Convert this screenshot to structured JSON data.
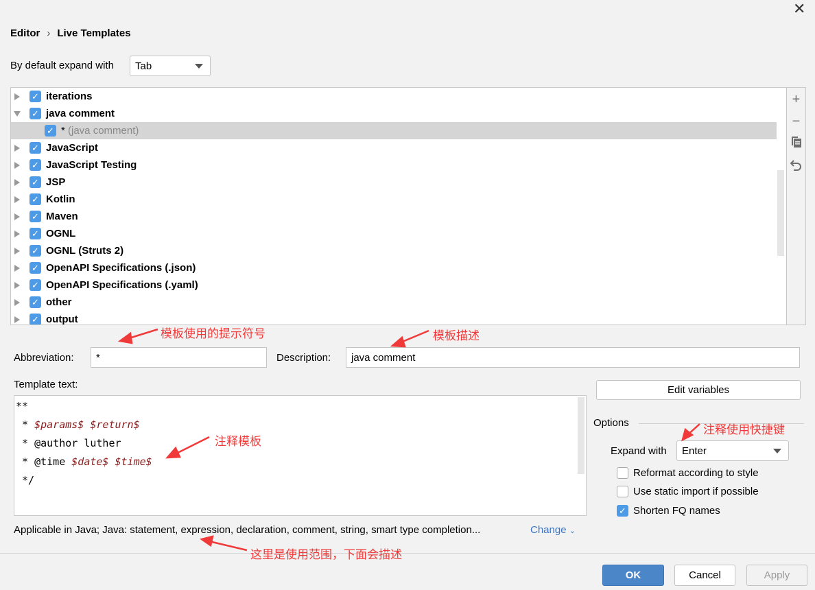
{
  "breadcrumb": {
    "parent": "Editor",
    "current": "Live Templates"
  },
  "expand_default": {
    "label": "By default expand with",
    "value": "Tab"
  },
  "tree": [
    {
      "label": "iterations",
      "checked": true,
      "expanded": false,
      "level": 0
    },
    {
      "label": "java comment",
      "checked": true,
      "expanded": true,
      "level": 0
    },
    {
      "label": "*",
      "desc": "(java comment)",
      "checked": true,
      "level": 1,
      "selected": true
    },
    {
      "label": "JavaScript",
      "checked": true,
      "expanded": false,
      "level": 0
    },
    {
      "label": "JavaScript Testing",
      "checked": true,
      "expanded": false,
      "level": 0
    },
    {
      "label": "JSP",
      "checked": true,
      "expanded": false,
      "level": 0
    },
    {
      "label": "Kotlin",
      "checked": true,
      "expanded": false,
      "level": 0
    },
    {
      "label": "Maven",
      "checked": true,
      "expanded": false,
      "level": 0
    },
    {
      "label": "OGNL",
      "checked": true,
      "expanded": false,
      "level": 0
    },
    {
      "label": "OGNL (Struts 2)",
      "checked": true,
      "expanded": false,
      "level": 0
    },
    {
      "label": "OpenAPI Specifications (.json)",
      "checked": true,
      "expanded": false,
      "level": 0
    },
    {
      "label": "OpenAPI Specifications (.yaml)",
      "checked": true,
      "expanded": false,
      "level": 0
    },
    {
      "label": "other",
      "checked": true,
      "expanded": false,
      "level": 0
    },
    {
      "label": "output",
      "checked": true,
      "expanded": false,
      "level": 0
    }
  ],
  "toolbar": {
    "add": "+",
    "remove": "−",
    "copy": "copy-icon",
    "restore": "undo-icon"
  },
  "abbreviation": {
    "label": "Abbreviation:",
    "value": "*"
  },
  "description": {
    "label": "Description:",
    "value": "java comment"
  },
  "template_text": {
    "label": "Template text:",
    "lines": [
      [
        {
          "t": "**"
        }
      ],
      [
        {
          "t": " * "
        },
        {
          "t": "$params$",
          "v": true
        },
        {
          "t": " "
        },
        {
          "t": "$return$",
          "v": true
        }
      ],
      [
        {
          "t": " * @author luther"
        }
      ],
      [
        {
          "t": " * @time "
        },
        {
          "t": "$date$",
          "v": true
        },
        {
          "t": " "
        },
        {
          "t": "$time$",
          "v": true
        }
      ],
      [
        {
          "t": " */"
        }
      ]
    ]
  },
  "edit_variables": "Edit variables",
  "options": {
    "title": "Options",
    "expand_label": "Expand with",
    "expand_value": "Enter",
    "reformat": {
      "label": "Reformat according to style",
      "checked": false
    },
    "static_import": {
      "label": "Use static import if possible",
      "checked": false
    },
    "shorten_fq": {
      "label": "Shorten FQ names",
      "checked": true
    }
  },
  "applicable": {
    "text": "Applicable in Java; Java: statement, expression, declaration, comment, string, smart type completion...",
    "change": "Change"
  },
  "buttons": {
    "ok": "OK",
    "cancel": "Cancel",
    "apply": "Apply"
  },
  "annotations": {
    "abbr": "模板使用的提示符号",
    "desc": "模板描述",
    "template": "注释模板",
    "shortcut": "注释使用快捷键",
    "scope": "这里是使用范围，下面会描述"
  },
  "colors": {
    "accent": "#4a86c8",
    "checkbox": "#4d9be6",
    "annotation": "#f03a3a",
    "variable": "#8b1a1a"
  }
}
